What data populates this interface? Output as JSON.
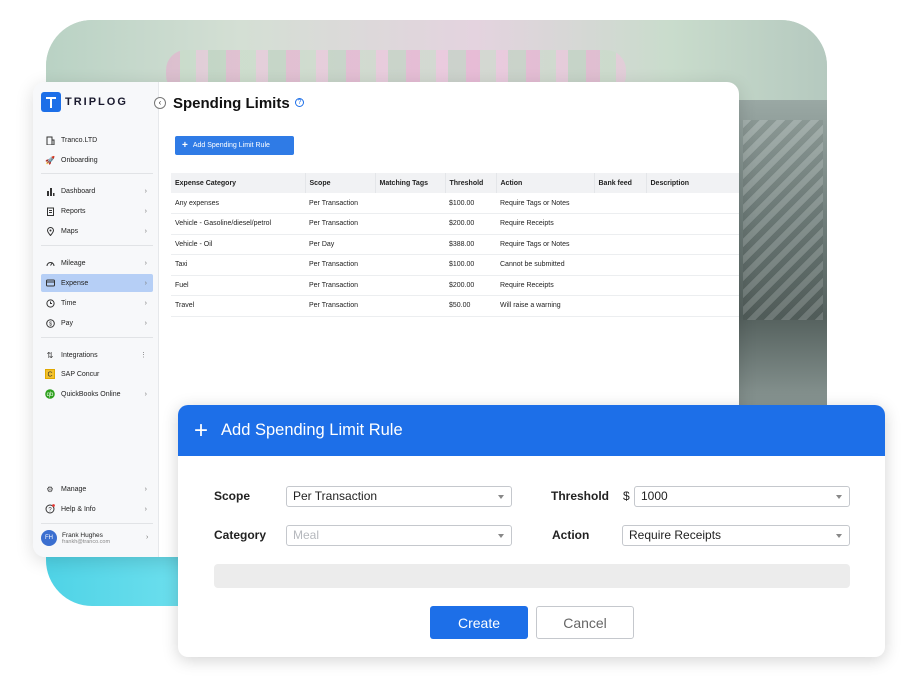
{
  "brand": {
    "name": "TRIPLOG"
  },
  "page": {
    "title": "Spending Limits",
    "help": "?"
  },
  "sidebar": {
    "collapse_icon": "chevron-left-icon",
    "items": [
      {
        "label": "Tranco.LTD",
        "icon": "building-icon"
      },
      {
        "label": "Onboarding",
        "icon": "rocket-icon"
      },
      {
        "label": "Dashboard",
        "icon": "bar-chart-icon",
        "chevron": "›"
      },
      {
        "label": "Reports",
        "icon": "report-icon",
        "chevron": "›"
      },
      {
        "label": "Maps",
        "icon": "pin-icon",
        "chevron": "›"
      },
      {
        "label": "Mileage",
        "icon": "gauge-icon",
        "chevron": "›"
      },
      {
        "label": "Expense",
        "icon": "card-icon",
        "chevron": "›",
        "active": true
      },
      {
        "label": "Time",
        "icon": "clock-icon",
        "chevron": "›"
      },
      {
        "label": "Pay",
        "icon": "dollar-icon",
        "chevron": "›"
      },
      {
        "label": "Integrations",
        "icon": "sync-icon",
        "chevron": "⋮"
      },
      {
        "label": "SAP Concur",
        "icon": "sap-concur-icon"
      },
      {
        "label": "QuickBooks Online",
        "icon": "quickbooks-icon",
        "chevron": "›"
      },
      {
        "label": "Manage",
        "icon": "gear-icon",
        "chevron": "›"
      },
      {
        "label": "Help & Info",
        "icon": "help-icon",
        "chevron": "›"
      }
    ],
    "user": {
      "initials": "FH",
      "name": "Frank Hughes",
      "email": "frankh@tranco.com",
      "chevron": "›"
    }
  },
  "toolbar": {
    "add_label": "Add Spending Limit Rule",
    "add_icon": "+"
  },
  "table": {
    "headers": [
      "Expense Category",
      "Scope",
      "Matching Tags",
      "Threshold",
      "Action",
      "Bank feed",
      "Description"
    ],
    "rows": [
      [
        "Any expenses",
        "Per Transaction",
        "",
        "$100.00",
        "Require Tags or Notes",
        "",
        ""
      ],
      [
        "Vehicle - Gasoline/diesel/petrol",
        "Per Transaction",
        "",
        "$200.00",
        "Require Receipts",
        "",
        ""
      ],
      [
        "Vehicle - Oil",
        "Per Day",
        "",
        "$388.00",
        "Require Tags or Notes",
        "",
        ""
      ],
      [
        "Taxi",
        "Per Transaction",
        "",
        "$100.00",
        "Cannot be submitted",
        "",
        ""
      ],
      [
        "Fuel",
        "Per Transaction",
        "",
        "$200.00",
        "Require Receipts",
        "",
        ""
      ],
      [
        "Travel",
        "Per Transaction",
        "",
        "$50.00",
        "Will raise a warning",
        "",
        ""
      ]
    ]
  },
  "modal": {
    "icon": "+",
    "title": "Add Spending Limit Rule",
    "scope_label": "Scope",
    "scope_value": "Per Transaction",
    "threshold_label": "Threshold",
    "currency": "$",
    "threshold_value": "1000",
    "category_label": "Category",
    "category_placeholder": "Meal",
    "action_label": "Action",
    "action_value": "Require Receipts",
    "create_label": "Create",
    "cancel_label": "Cancel"
  },
  "colors": {
    "accent": "#1d6fe8",
    "active_nav": "#b6cff6",
    "add_button": "#2f7be6"
  }
}
